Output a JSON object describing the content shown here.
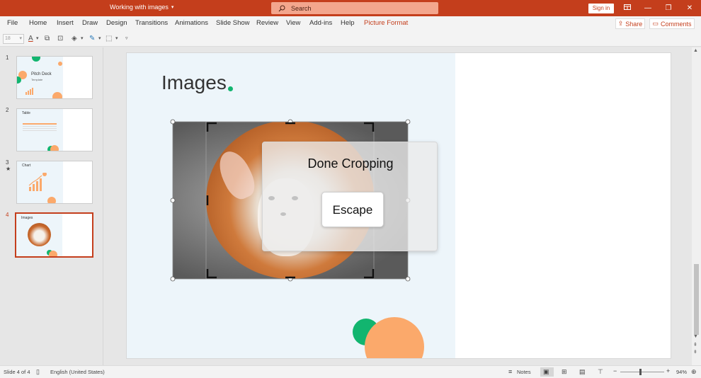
{
  "titlebar": {
    "doc_title": "Working with images",
    "search_placeholder": "Search",
    "signin_label": "Sign in"
  },
  "menu": {
    "items": [
      "File",
      "Home",
      "Insert",
      "Draw",
      "Design",
      "Transitions",
      "Animations",
      "Slide Show",
      "Review",
      "View",
      "Add-ins",
      "Help",
      "Picture Format"
    ],
    "share_label": "Share",
    "comments_label": "Comments"
  },
  "toolbar": {
    "font_size": "18"
  },
  "thumbnails": [
    {
      "num": "1",
      "title": "Pitch Deck",
      "subtitle": "Template"
    },
    {
      "num": "2",
      "title": "Table"
    },
    {
      "num": "3",
      "title": "Chart",
      "star": "★"
    },
    {
      "num": "4",
      "title": "Images"
    }
  ],
  "slide": {
    "title": "Images"
  },
  "overlay": {
    "done_label": "Done Cropping",
    "escape_label": "Escape"
  },
  "status": {
    "slide_info": "Slide 4 of 4",
    "language": "English (United States)",
    "notes_label": "Notes",
    "zoom_level": "94%"
  },
  "colors": {
    "accent": "#c43e1c",
    "green": "#12b56f",
    "orange": "#fba96b"
  }
}
